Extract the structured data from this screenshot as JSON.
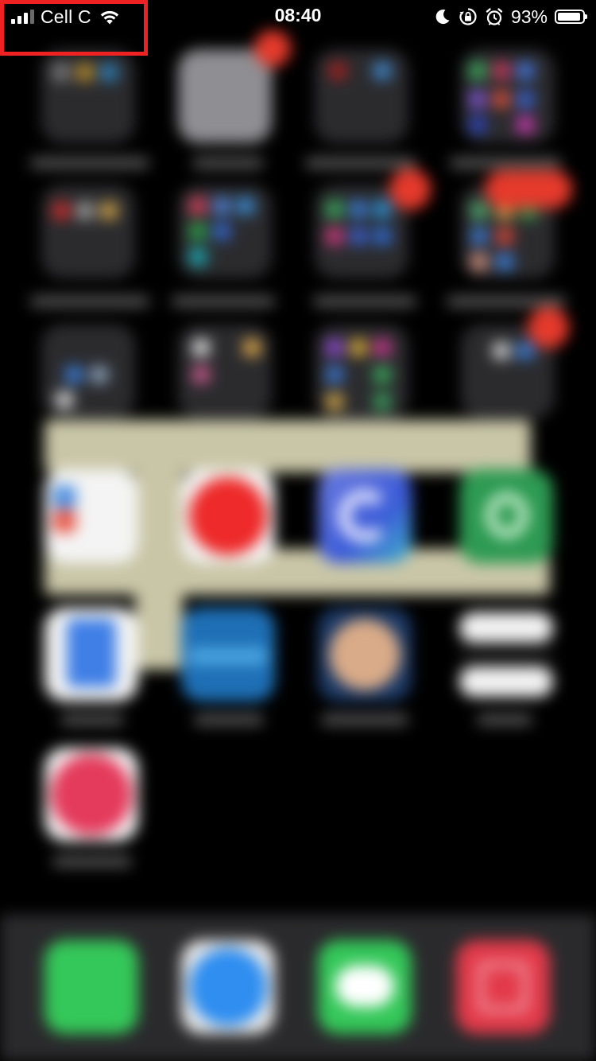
{
  "status_bar": {
    "carrier": "Cell C",
    "time": "08:40",
    "battery_percent": "93%",
    "battery_level": 0.93,
    "signal_bars_active": 3,
    "signal_bars_total": 4,
    "icons": [
      "signal-icon",
      "wifi-icon",
      "moon-icon",
      "orientation-lock-icon",
      "alarm-icon",
      "battery-icon"
    ],
    "highlight_color": "#ee2222"
  },
  "home_screen": {
    "state": "blurred",
    "badge_color": "#e53a2c",
    "badge_count": "2"
  },
  "dock": {
    "apps": [
      "phone-icon",
      "safari-icon",
      "messages-icon",
      "calendar-icon"
    ]
  }
}
